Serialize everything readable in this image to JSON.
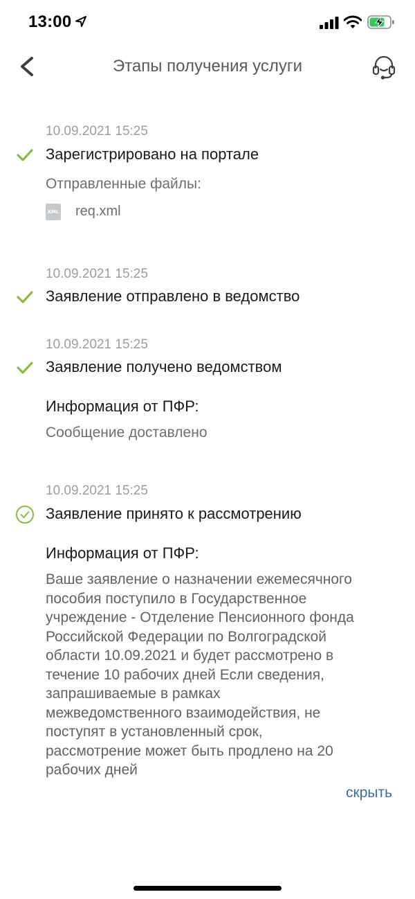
{
  "status_bar": {
    "time": "13:00",
    "icons": [
      "location-arrow-icon",
      "cellular-signal-icon",
      "wifi-icon",
      "battery-charging-icon"
    ]
  },
  "nav": {
    "title": "Этапы получения услуги",
    "back_icon": "chevron-left-icon",
    "support_icon": "headset-icon"
  },
  "stages": [
    {
      "date": "10.09.2021 15:25",
      "title": "Зарегистрировано на портале",
      "status_icon": "check-icon",
      "files_label": "Отправленные файлы:",
      "files": [
        {
          "type_badge": "XML",
          "name": "req.xml"
        }
      ]
    },
    {
      "date": "10.09.2021 15:25",
      "title": "Заявление отправлено в ведомство",
      "status_icon": "check-icon"
    },
    {
      "date": "10.09.2021 15:25",
      "title": "Заявление получено ведомством",
      "status_icon": "check-icon",
      "info_label": "Информация от ПФР:",
      "info_text": "Сообщение доставлено"
    },
    {
      "date": "10.09.2021 15:25",
      "title": "Заявление принято к рассмотрению",
      "status_icon": "circle-check-icon",
      "info_label": "Информация от ПФР:",
      "info_text_lines": [
        "Ваше заявление о назначении ежемесячного",
        "пособия поступило в Государственное",
        "учреждение - Отделение Пенсионного фонда",
        "Российской Федерации по Волгоградской",
        "области 10.09.2021 и будет рассмотрено в",
        "течение 10 рабочих дней Если сведения,",
        "запрашиваемые в рамках",
        "межведомственного взаимодействия, не",
        "поступят в установленный срок,",
        "рассмотрение может быть продлено на 20",
        "рабочих дней"
      ],
      "hide_label": "скрыть"
    }
  ],
  "colors": {
    "check_green": "#8bbd3c",
    "link_blue": "#3a6ea5",
    "date_gray": "#9a9ea2"
  }
}
